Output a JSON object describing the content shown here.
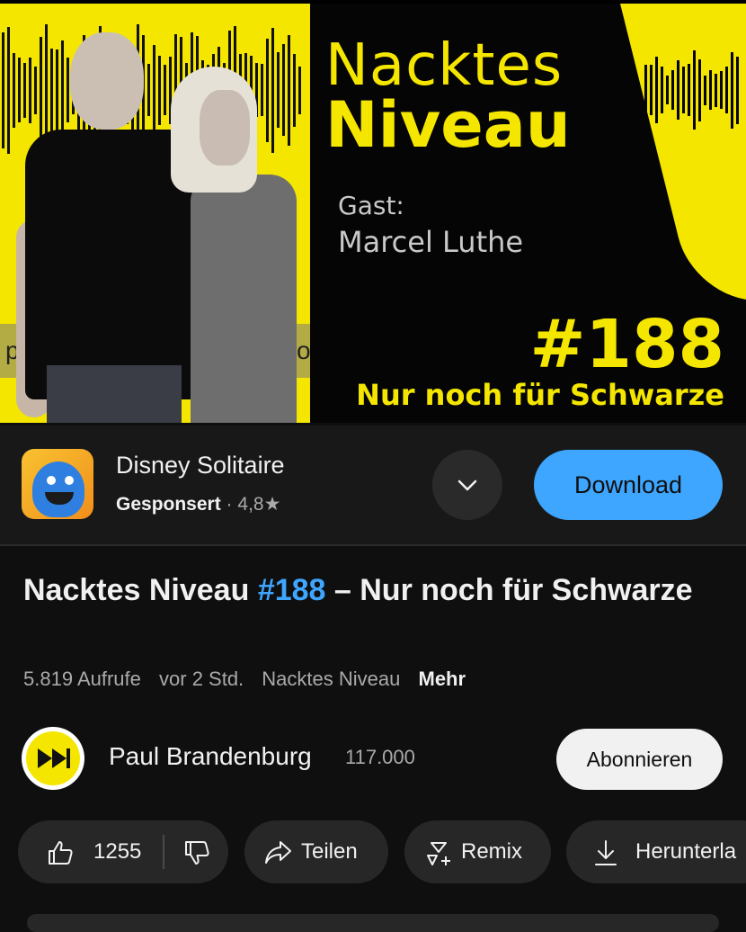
{
  "thumbnail": {
    "title_line1": "Nacktes",
    "title_line2": "Niveau",
    "guest_label": "Gast:",
    "guest_name": "Marcel Luthe",
    "episode": "#188",
    "subtitle": "Nur noch für Schwarze",
    "strip_left": "p",
    "strip_right": "o",
    "accent_color": "#f5e600"
  },
  "ad": {
    "app_name": "Disney Solitaire",
    "sponsored": "Gesponsert",
    "separator": "·",
    "rating": "4,8",
    "star": "★",
    "download_label": "Download",
    "icon": "genie-app-icon",
    "button_color": "#3ea6ff"
  },
  "video": {
    "title_part1": "Nacktes Niveau ",
    "title_tag": "#188",
    "title_part2": " – Nur noch für Schwarze",
    "views": "5.819 Aufrufe",
    "age": "vor 2 Std.",
    "tag_series": "Nacktes Niveau",
    "more": "Mehr"
  },
  "channel": {
    "name": "Paul Brandenburg",
    "subscribers": "117.000",
    "subscribe_label": "Abonnieren"
  },
  "actions": {
    "likes": "1255",
    "share": "Teilen",
    "remix": "Remix",
    "download": "Herunterla"
  }
}
